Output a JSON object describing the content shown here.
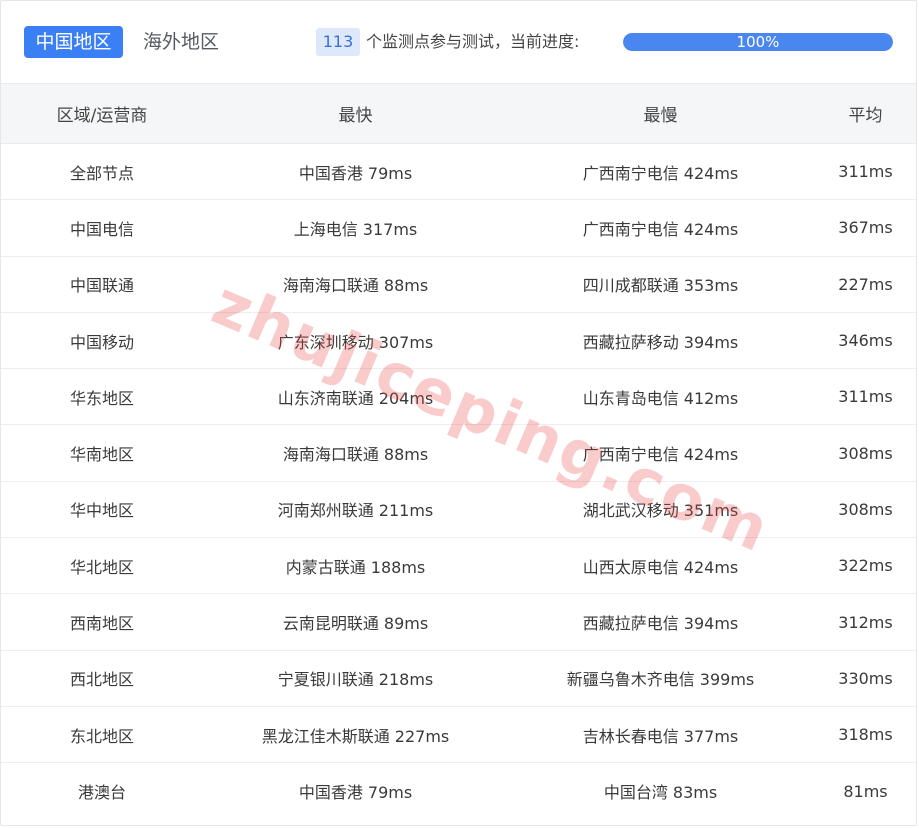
{
  "tabs": {
    "active_label": "中国地区",
    "inactive_label": "海外地区"
  },
  "status": {
    "node_count": "113",
    "count_text": "个监测点参与测试，当前进度:",
    "progress_label": "100%",
    "progress_value": 1.0
  },
  "colors": {
    "accent": "#3b7ff5",
    "badge_bg": "#dde8fb",
    "watermark": "#eb4646"
  },
  "table": {
    "headers": [
      "区域/运营商",
      "最快",
      "最慢",
      "平均"
    ],
    "rows": [
      [
        "全部节点",
        "中国香港 79ms",
        "广西南宁电信 424ms",
        "311ms"
      ],
      [
        "中国电信",
        "上海电信 317ms",
        "广西南宁电信 424ms",
        "367ms"
      ],
      [
        "中国联通",
        "海南海口联通 88ms",
        "四川成都联通 353ms",
        "227ms"
      ],
      [
        "中国移动",
        "广东深圳移动 307ms",
        "西藏拉萨移动 394ms",
        "346ms"
      ],
      [
        "华东地区",
        "山东济南联通 204ms",
        "山东青岛电信 412ms",
        "311ms"
      ],
      [
        "华南地区",
        "海南海口联通 88ms",
        "广西南宁电信 424ms",
        "308ms"
      ],
      [
        "华中地区",
        "河南郑州联通 211ms",
        "湖北武汉移动 351ms",
        "308ms"
      ],
      [
        "华北地区",
        "内蒙古联通 188ms",
        "山西太原电信 424ms",
        "322ms"
      ],
      [
        "西南地区",
        "云南昆明联通 89ms",
        "西藏拉萨电信 394ms",
        "312ms"
      ],
      [
        "西北地区",
        "宁夏银川联通 218ms",
        "新疆乌鲁木齐电信 399ms",
        "330ms"
      ],
      [
        "东北地区",
        "黑龙江佳木斯联通 227ms",
        "吉林长春电信 377ms",
        "318ms"
      ],
      [
        "港澳台",
        "中国香港 79ms",
        "中国台湾 83ms",
        "81ms"
      ]
    ]
  },
  "watermark_text": "zhujiceping.com"
}
